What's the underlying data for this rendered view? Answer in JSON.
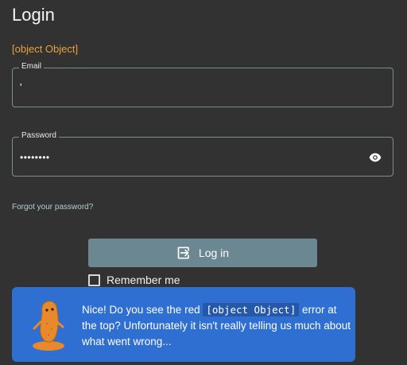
{
  "page": {
    "title": "Login",
    "error_message": "[object Object]"
  },
  "form": {
    "email": {
      "label": "Email",
      "value": "'"
    },
    "password": {
      "label": "Password",
      "value": "••••••••"
    },
    "forgot_link": "Forgot your password?",
    "login_label": "Log in",
    "remember_label": "Remember me",
    "remember_checked": false
  },
  "tip": {
    "text_before": "Nice! Do you see the red ",
    "code": "[object Object]",
    "text_after": " error at the top? Unfortunately it isn't really telling us much about what went wrong..."
  },
  "colors": {
    "background": "#323232",
    "error": "#e8a23c",
    "button": "#6b8791",
    "tip_background": "#2e6fd1"
  }
}
